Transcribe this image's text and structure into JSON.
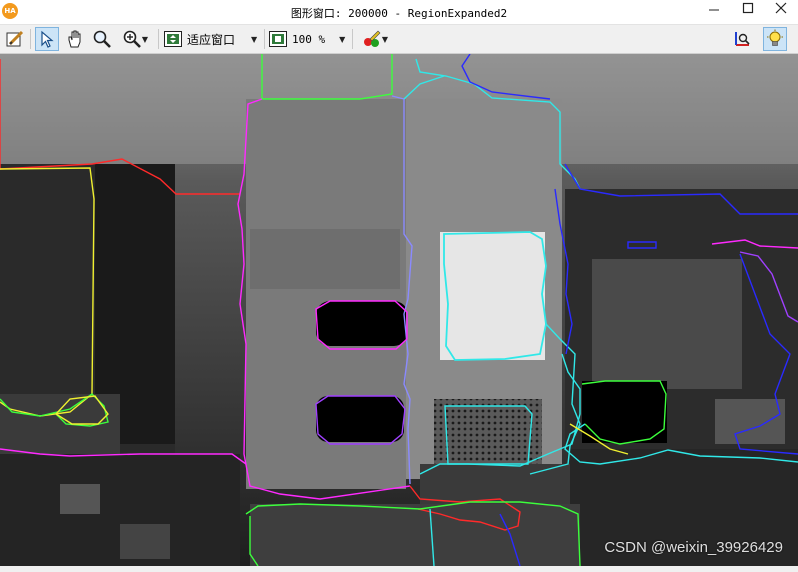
{
  "window": {
    "app_icon_text": "HA",
    "title": "图形窗口: 200000 - RegionExpanded2",
    "minimize_icon": "minimize-icon",
    "maximize_icon": "maximize-icon",
    "close_icon": "close-icon"
  },
  "toolbar": {
    "tools": [
      {
        "name": "edit-tool-icon"
      },
      {
        "name": "pointer-tool-icon",
        "active": true
      },
      {
        "name": "pan-hand-icon"
      },
      {
        "name": "magnify-icon"
      },
      {
        "name": "zoom-in-icon"
      }
    ],
    "fit_label": "适应窗口",
    "zoom_value": "100 %",
    "color_tool_icon": "color-palette-icon",
    "coord_axis_icon": "axis-cursor-icon",
    "help_icon": "lightbulb-icon"
  },
  "colors": {
    "region_red": "#ff2a2a",
    "region_green": "#3cff3c",
    "region_blue": "#2a2aff",
    "region_cyan": "#30e8e8",
    "region_magenta": "#ff2aff",
    "region_yellow": "#f0f030",
    "region_purple": "#a040ff"
  },
  "watermark": "CSDN @weixin_39926429"
}
